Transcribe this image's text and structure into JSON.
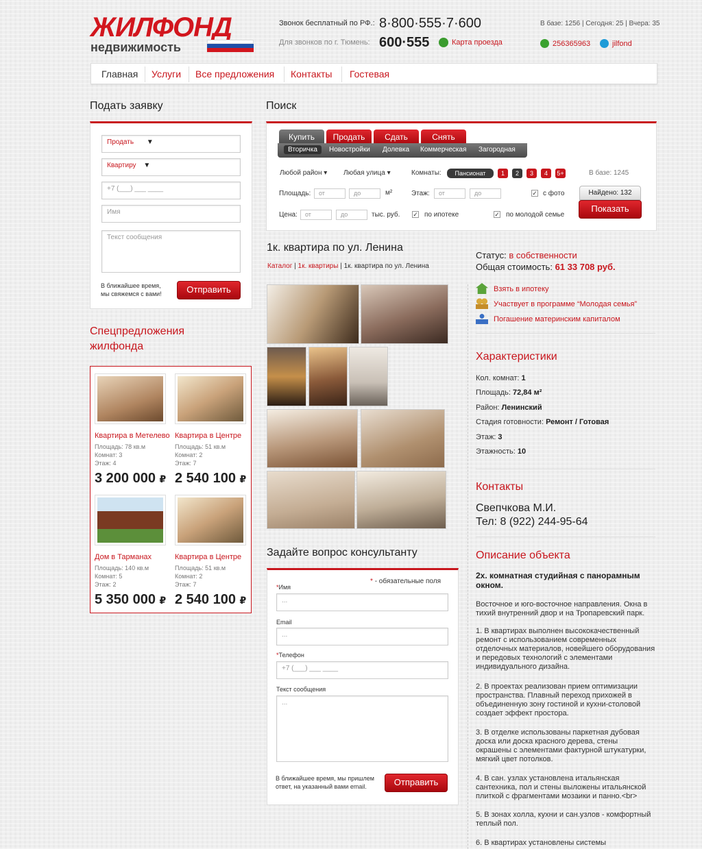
{
  "header": {
    "logo_main": "ЖИЛФОНД",
    "logo_sub": "недвижимость",
    "free_call_label": "Звонок бесплатный по РФ.:",
    "free_call_phone": "8·800·555·7·600",
    "city_call_label": "Для звонков по г. Тюмень:",
    "city_phone": "600·555",
    "map_link": "Карта проезда",
    "stats": "В базе: 1256 | Сегодня: 25 | Вчера: 35",
    "icq": "256365963",
    "skype": "jilfond"
  },
  "nav": {
    "items": [
      "Главная",
      "Услуги",
      "Все предложения",
      "Контакты",
      "Гостевая"
    ]
  },
  "request_form": {
    "title": "Подать заявку",
    "type_select": "Продать",
    "object_select": "Квартиру",
    "phone_placeholder": "+7 (___) ___ ____",
    "name_placeholder": "Имя",
    "message_placeholder": "Текст сообщения",
    "note": "В ближайшее время, мы свяжемся с вами!",
    "submit": "Отправить"
  },
  "specials": {
    "title_line1": "Спецпредложения",
    "title_line2": "жилфонда",
    "items": [
      {
        "title": "Квартира в Метелево",
        "area": "Площадь: 78 кв.м",
        "rooms": "Комнат: 3",
        "floor": "Этаж: 4",
        "price": "3 200 000",
        "currency": "₽"
      },
      {
        "title": "Квартира в Центре",
        "area": "Площадь: 51 кв.м",
        "rooms": "Комнат: 2",
        "floor": "Этаж: 7",
        "price": "2 540 100",
        "currency": "₽"
      },
      {
        "title": "Дом в Тарманах",
        "area": "Площадь: 140 кв.м",
        "rooms": "Комнат: 5",
        "floor": "Этаж: 2",
        "price": "5 350 000",
        "currency": "₽"
      },
      {
        "title": "Квартира в Центре",
        "area": "Площадь: 51 кв.м",
        "rooms": "Комнат: 2",
        "floor": "Этаж: 7",
        "price": "2 540 100",
        "currency": "₽"
      }
    ]
  },
  "search": {
    "title": "Поиск",
    "tabs": [
      "Купить",
      "Продать",
      "Сдать",
      "Снять"
    ],
    "subtabs": [
      "Вторичка",
      "Новостройки",
      "Долевка",
      "Коммерческая",
      "Загородная"
    ],
    "district": "Любой район",
    "street": "Любая улица",
    "rooms_label": "Комнаты:",
    "rooms_options": [
      "Пансионат",
      "1",
      "2",
      "3",
      "4",
      "5+"
    ],
    "in_base": "В базе: 1245",
    "area_label": "Площадь:",
    "floor_label": "Этаж:",
    "price_label": "Цена:",
    "from": "от",
    "to": "до",
    "area_unit": "м²",
    "price_unit": "тыс. руб.",
    "with_photo": "с фото",
    "mortgage": "по ипотеке",
    "young_family": "по молодой семье",
    "found": "Найдено: 132",
    "show_button": "Показать"
  },
  "listing": {
    "title": "1к. квартира по ул. Ленина",
    "breadcrumb": [
      "Каталог",
      "1к. квартиры",
      "1к. квартира по ул. Ленина"
    ],
    "status_label": "Статус:",
    "status_value": "в собственности",
    "total_label": "Общая стоимость:",
    "total_value": "61 33 708 руб.",
    "options": [
      "Взять в ипотеку",
      "Участвует в программе “Молодая семья”",
      "Погашение материнским капиталом"
    ],
    "specs_title": "Характеристики",
    "specs": [
      {
        "label": "Кол. комнат:",
        "value": "1"
      },
      {
        "label": "Площадь:",
        "value": "72,84 м²"
      },
      {
        "label": "Район:",
        "value": "Ленинский"
      },
      {
        "label": "Стадия готовности:",
        "value": "Ремонт / Готовая"
      },
      {
        "label": "Этаж:",
        "value": "3"
      },
      {
        "label": "Этажность:",
        "value": "10"
      }
    ],
    "contacts_title": "Контакты",
    "contact_name": "Свепчкова М.И.",
    "contact_phone": "Тел: 8 (922) 244-95-64",
    "description_title": "Описание объекта",
    "description_lead": "2х. комнатная студийная с панорамным окном.",
    "description_paragraphs": [
      "Восточное и юго-восточное направления. Окна в тихий внутренний двор и на Тропаревский парк.",
      "1.  В квартирах выполнен высококачественный ремонт  с использованием современных отделочных материалов, новейшего оборудования и передовых технологий с элементами индивидуального дизайна.",
      "2.  В проектах реализован прием оптимизации пространства. Плавный переход прихожей в объединенную зону гостиной и кухни-столовой создает эффект  простора.",
      "3.  В отделке использованы  паркетная дубовая доска или доска красного дерева, стены окрашены с элементами фактурной штукатурки, мягкий цвет потолков.",
      "4.  В сан. узлах установлена итальянская сантехника, пол и стены выложены итальянской плиткой с фрагментами мозаики и панно.<br>",
      "5.  В зонах холла, кухни и сан.узлов - комфортный теплый пол.",
      "6.  В квартирах  установлены  системы"
    ]
  },
  "question_form": {
    "title": "Задайте вопрос консультанту",
    "required_note": "- обязательные поля",
    "name_label": "Имя",
    "email_label": "Email",
    "phone_label": "Телефон",
    "message_label": "Текст сообщения",
    "name_placeholder": "...",
    "email_placeholder": "...",
    "phone_placeholder": "+7 (___) ___ ____",
    "message_placeholder": "...",
    "note": "В ближайшее время, мы пришлем ответ, на указанный вами email.",
    "submit": "Отправить"
  },
  "colors": {
    "accent": "#c8161d",
    "dark": "#4a4a4a",
    "flag_blue": "#1f4fa8"
  }
}
